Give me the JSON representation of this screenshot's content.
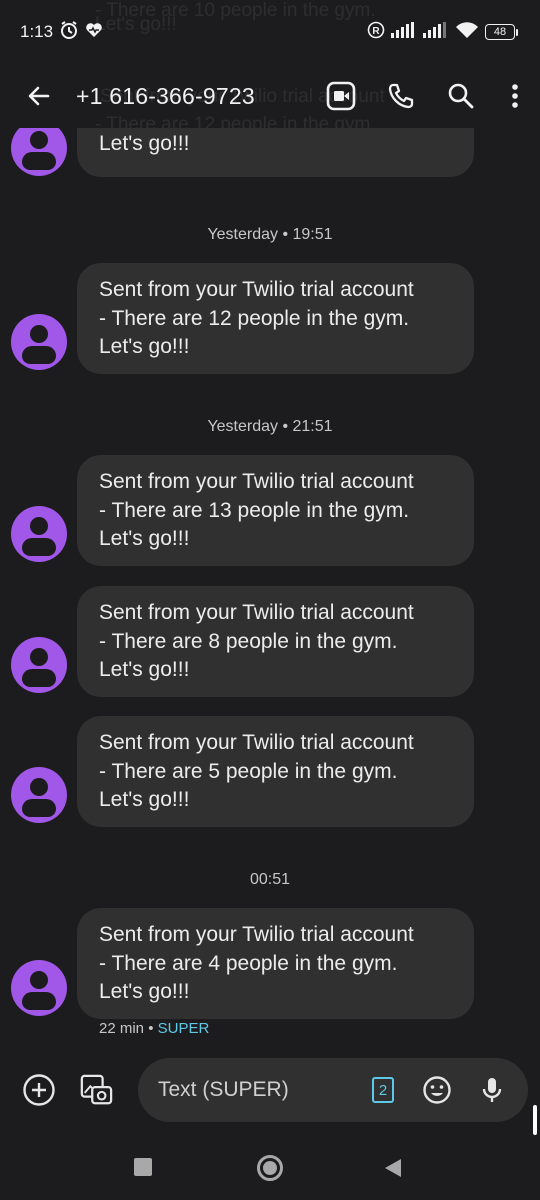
{
  "status_bar": {
    "time": "1:13",
    "battery": "48"
  },
  "ghost_overlay": {
    "line1": "- There are 10 people in the gym.",
    "line2": "Let's go!!!",
    "line3": "Sent from your Twilio trial account",
    "line4": "- There are 12 people in the gym."
  },
  "app_bar": {
    "contact": "+1 616-366-9723",
    "icons": [
      "back-arrow-icon",
      "video-call-icon",
      "phone-icon",
      "search-icon",
      "more-vert-icon"
    ]
  },
  "messages": [
    {
      "text_lines": [
        "Let's go!!!"
      ]
    },
    {
      "timestamp": "Yesterday • 19:51"
    },
    {
      "text_lines": [
        "Sent from your Twilio trial account",
        "- There are 12 people in the gym.",
        "Let's go!!!"
      ]
    },
    {
      "timestamp": "Yesterday • 21:51"
    },
    {
      "text_lines": [
        "Sent from your Twilio trial account",
        "- There are 13 people in the gym.",
        "Let's go!!!"
      ]
    },
    {
      "text_lines": [
        "Sent from your Twilio trial account",
        "- There are 8 people in the gym.",
        "Let's go!!!"
      ]
    },
    {
      "text_lines": [
        "Sent from your Twilio trial account",
        "- There are 5 people in the gym.",
        "Let's go!!!"
      ]
    },
    {
      "timestamp": "00:51"
    },
    {
      "text_lines": [
        "Sent from your Twilio trial account",
        "- There are 4 people in the gym.",
        "Let's go!!!"
      ]
    }
  ],
  "last_meta": {
    "time_ago": "22 min",
    "separator": "•",
    "sim": "SUPER"
  },
  "compose": {
    "placeholder": "Text (SUPER)",
    "sim_number": "2",
    "icons": [
      "add-circle-icon",
      "gallery-icon",
      "emoji-icon",
      "mic-icon"
    ]
  },
  "colors": {
    "background": "#1c1c1e",
    "bubble": "#303030",
    "avatar": "#a158e8",
    "accent": "#5ec8e6"
  }
}
